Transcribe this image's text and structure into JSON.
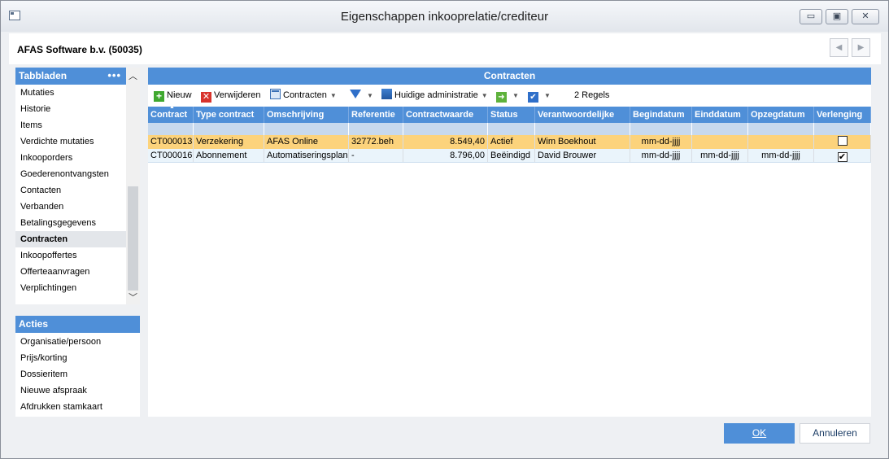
{
  "window": {
    "title": "Eigenschappen inkooprelatie/crediteur",
    "min_symbol": "▭",
    "max_symbol": "▣",
    "close_symbol": "✕"
  },
  "header": {
    "company": "AFAS Software b.v. (50035)",
    "prev_symbol": "◀",
    "next_symbol": "▶"
  },
  "tabbladen": {
    "title": "Tabbladen",
    "menu_symbol": "•••",
    "scroll_up_symbol": "︿",
    "scroll_down_symbol": "﹀",
    "items": [
      {
        "label": "Mutaties"
      },
      {
        "label": "Historie"
      },
      {
        "label": "Items"
      },
      {
        "label": "Verdichte mutaties"
      },
      {
        "label": "Inkooporders"
      },
      {
        "label": "Goederenontvangsten"
      },
      {
        "label": "Contacten"
      },
      {
        "label": "Verbanden"
      },
      {
        "label": "Betalingsgegevens"
      },
      {
        "label": "Contracten"
      },
      {
        "label": "Inkoopoffertes"
      },
      {
        "label": "Offerteaanvragen"
      },
      {
        "label": "Verplichtingen"
      }
    ],
    "active_index": 9
  },
  "acties": {
    "title": "Acties",
    "items": [
      {
        "label": "Organisatie/persoon"
      },
      {
        "label": "Prijs/korting"
      },
      {
        "label": "Dossieritem"
      },
      {
        "label": "Nieuwe afspraak"
      },
      {
        "label": "Afdrukken stamkaart"
      }
    ]
  },
  "main": {
    "title": "Contracten",
    "toolbar": {
      "new_icon": "+",
      "new_label": "Nieuw",
      "delete_icon": "✕",
      "delete_label": "Verwijderen",
      "contracts_label": "Contracten",
      "admin_label": "Huidige administratie",
      "arrow_icon": "➜",
      "check_icon": "✔",
      "caret": "▼",
      "count_label": "2 Regels"
    },
    "grid": {
      "sort_indicator": "▲",
      "columns": [
        "Contract",
        "Type contract",
        "Omschrijving",
        "Referentie",
        "Contractwaarde",
        "Status",
        "Verantwoordelijke",
        "Begindatum",
        "Einddatum",
        "Opzegdatum",
        "Verlenging"
      ],
      "rows": [
        {
          "contract": "CT000013",
          "type": "Verzekering",
          "omschrijving": "AFAS Online",
          "referentie": "32772.beh",
          "waarde": "8.549,40",
          "status": "Actief",
          "verantwoordelijke": "Wim Boekhout",
          "begindatum": "mm-dd-jjjj",
          "einddatum": "",
          "opzegdatum": "",
          "verlenging": ""
        },
        {
          "contract": "CT000016",
          "type": "Abonnement",
          "omschrijving": "Automatiseringsplan",
          "referentie": "-",
          "waarde": "8.796,00",
          "status": "Beëindigd",
          "verantwoordelijke": "David Brouwer",
          "begindatum": "mm-dd-jjjj",
          "einddatum": "mm-dd-jjjj",
          "opzegdatum": "mm-dd-jjjj",
          "verlenging": "✔"
        }
      ]
    }
  },
  "footer": {
    "ok_label": "OK",
    "cancel_label": "Annuleren"
  },
  "colors": {
    "accent": "#4f8fd8",
    "selected_row": "#fcd37c",
    "alt_row": "#eaf4fb"
  }
}
